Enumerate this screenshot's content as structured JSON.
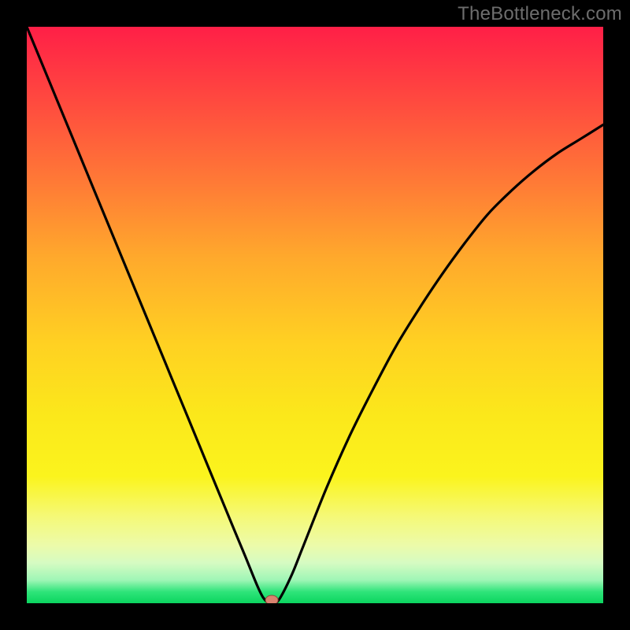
{
  "watermark": "TheBottleneck.com",
  "chart_data": {
    "type": "line",
    "title": "",
    "xlabel": "",
    "ylabel": "",
    "xlim": [
      0,
      100
    ],
    "ylim": [
      0,
      100
    ],
    "x": [
      0,
      4,
      8,
      12,
      16,
      20,
      24,
      28,
      32,
      36,
      38,
      40,
      41,
      42,
      43,
      44,
      46,
      48,
      52,
      56,
      60,
      64,
      68,
      72,
      76,
      80,
      84,
      88,
      92,
      96,
      100
    ],
    "values": [
      100,
      90.3,
      80.6,
      70.9,
      61.2,
      51.5,
      41.8,
      32.1,
      22.4,
      12.7,
      7.9,
      3.0,
      1.0,
      0.0,
      0.0,
      1.0,
      5.0,
      10.0,
      20.0,
      29.0,
      37.0,
      44.5,
      51.0,
      57.0,
      62.5,
      67.5,
      71.5,
      75.0,
      78.0,
      80.5,
      83.0
    ],
    "marker": {
      "x": 42.5,
      "y": 0
    },
    "background": "vertical rainbow gradient red→green",
    "axes": "none"
  },
  "colors": {
    "frame": "#000000",
    "curve": "#000000",
    "marker_fill": "#d9836f",
    "marker_stroke": "#8f4a3b"
  }
}
